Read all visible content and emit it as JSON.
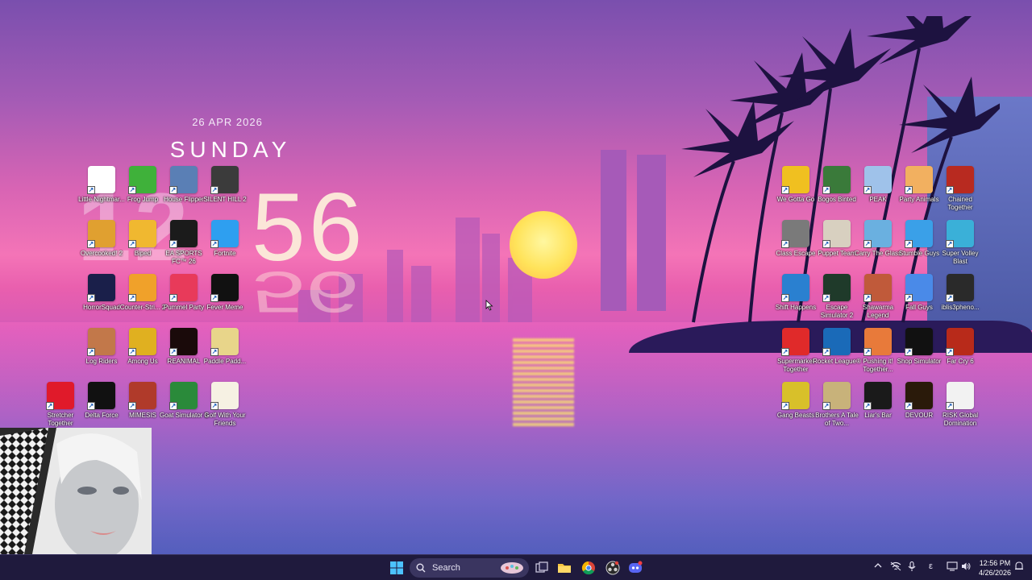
{
  "clock": {
    "date": "26 APR 2026",
    "day": "SUNDAY",
    "hour": "12",
    "minute": "56"
  },
  "desktop_icons_left": [
    {
      "label": "Little Nightmar...",
      "icon": "little-nightmares-icon",
      "color": "#ffffff"
    },
    {
      "label": "Frog Jump",
      "icon": "frog-icon",
      "color": "#3fb13a"
    },
    {
      "label": "House Flipper",
      "icon": "house-icon",
      "color": "#5a7fb5"
    },
    {
      "label": "SILENT HILL 2",
      "icon": "silent-hill-icon",
      "color": "#3b3b3b"
    },
    {
      "label": "Overcooked! 2",
      "icon": "overcooked-icon",
      "color": "#e0a030"
    },
    {
      "label": "Biped",
      "icon": "robot-icon",
      "color": "#f0b830"
    },
    {
      "label": "EA SPORTS FC™ 26",
      "icon": "fc26-icon",
      "color": "#1b1b1b"
    },
    {
      "label": "Fortnite",
      "icon": "fortnite-icon",
      "color": "#2e9ff0"
    },
    {
      "label": "HorrorSquad",
      "icon": "horror-squad-icon",
      "color": "#1a1f4a"
    },
    {
      "label": "Counter-Stri... 2",
      "icon": "counter-strike-icon",
      "color": "#f0a12a"
    },
    {
      "label": "Pummel Party",
      "icon": "dice-icon",
      "color": "#e83a5a"
    },
    {
      "label": "Fever Meme",
      "icon": "fever-meme-icon",
      "color": "#111111"
    },
    {
      "label": "Log Riders",
      "icon": "log-riders-icon",
      "color": "#c2784a"
    },
    {
      "label": "Among Us",
      "icon": "among-us-icon",
      "color": "#e0b020"
    },
    {
      "label": "REANIMAL",
      "icon": "reanimal-icon",
      "color": "#1a0a0a"
    },
    {
      "label": "Paddle Padd...",
      "icon": "paddle-icon",
      "color": "#e8d58a"
    },
    {
      "label": "Stretcher Together",
      "icon": "cross-icon",
      "color": "#e01a2a"
    },
    {
      "label": "Delta Force",
      "icon": "delta-force-icon",
      "color": "#111111"
    },
    {
      "label": "MIMESIS",
      "icon": "mimesis-icon",
      "color": "#b03a2a"
    },
    {
      "label": "Goat Simulator 3",
      "icon": "goat-icon",
      "color": "#2a8a3a"
    },
    {
      "label": "Golf With Your Friends",
      "icon": "golf-icon",
      "color": "#f6f1e3"
    }
  ],
  "desktop_icons_right": [
    {
      "label": "We Gotta Go",
      "icon": "scared-face-icon",
      "color": "#f0c020"
    },
    {
      "label": "Bogos Binted",
      "icon": "alien-icon",
      "color": "#3a7a3a"
    },
    {
      "label": "PEAK",
      "icon": "peak-icon",
      "color": "#9fc2ea"
    },
    {
      "label": "Party Animals",
      "icon": "party-animals-icon",
      "color": "#f2b060"
    },
    {
      "label": "Chained Together",
      "icon": "chained-together-icon",
      "color": "#b82a20"
    },
    {
      "label": "Class Escape",
      "icon": "class-escape-icon",
      "color": "#7a7a7a"
    },
    {
      "label": "Puppet Team",
      "icon": "puppet-team-icon",
      "color": "#d8d0c0"
    },
    {
      "label": "Carry The Glass",
      "icon": "carry-glass-icon",
      "color": "#6ab0e0"
    },
    {
      "label": "Stumble Guys",
      "icon": "stumble-guys-icon",
      "color": "#3aa0e8"
    },
    {
      "label": "Super Volley Blast",
      "icon": "volleyball-icon",
      "color": "#3ab0d8"
    },
    {
      "label": "Shift Happens",
      "icon": "shift-happens-icon",
      "color": "#2a80d0"
    },
    {
      "label": "Escape Simulator 2",
      "icon": "keyhole-icon",
      "color": "#1f3a2a"
    },
    {
      "label": "Shawarma Legend",
      "icon": "shawarma-icon",
      "color": "#c05a3a"
    },
    {
      "label": "Fall Guys",
      "icon": "fall-guys-icon",
      "color": "#4a8ae8"
    },
    {
      "label": "iblis3pheno...",
      "icon": "iblis-icon",
      "color": "#2a2a2a"
    },
    {
      "label": "Supermarket Together",
      "icon": "supermarket-icon",
      "color": "#e02a2a"
    },
    {
      "label": "Rocket League®",
      "icon": "rocket-league-icon",
      "color": "#1a6ab8"
    },
    {
      "label": "Pushing it! Together...",
      "icon": "pushing-it-icon",
      "color": "#e87a3a"
    },
    {
      "label": "Shop Simulator",
      "icon": "dollar-icon",
      "color": "#111111"
    },
    {
      "label": "Far Cry 6",
      "icon": "far-cry-icon",
      "color": "#b82a1a"
    },
    {
      "label": "Gang Beasts",
      "icon": "gang-beasts-icon",
      "color": "#d8c02a"
    },
    {
      "label": "Brothers A Tale of Two...",
      "icon": "brothers-icon",
      "color": "#c8b27a"
    },
    {
      "label": "Liar's Bar",
      "icon": "liars-bar-icon",
      "color": "#1a1a1a"
    },
    {
      "label": "DEVOUR",
      "icon": "devour-icon",
      "color": "#2a1a0a"
    },
    {
      "label": "RISK Global Domination",
      "icon": "risk-icon",
      "color": "#f2f2f2"
    }
  ],
  "taskbar": {
    "search_placeholder": "Search",
    "apps": [
      {
        "name": "start-icon"
      },
      {
        "name": "search-icon"
      },
      {
        "name": "widgets-icon"
      },
      {
        "name": "task-view-icon"
      },
      {
        "name": "file-explorer-icon"
      },
      {
        "name": "chrome-icon"
      },
      {
        "name": "obs-icon"
      },
      {
        "name": "discord-icon"
      }
    ],
    "tray": {
      "time": "12:56 PM",
      "date": "4/26/2026",
      "lang": "ε"
    }
  },
  "colors": {
    "taskbar_bg": "#1f1a3d",
    "accent": "#4cc2ff"
  }
}
